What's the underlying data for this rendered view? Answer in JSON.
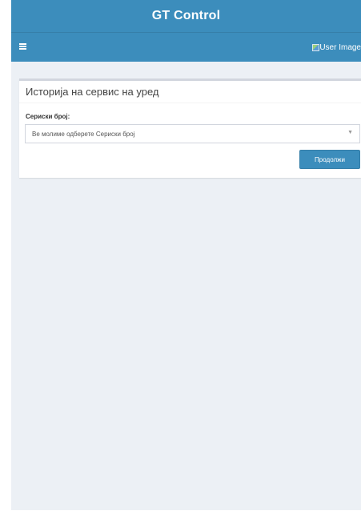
{
  "app": {
    "title": "GT Control"
  },
  "navbar": {
    "user_image_alt": "User Image"
  },
  "panel": {
    "title": "Историја на сервис на уред",
    "serial_label": "Сериски број:",
    "serial_placeholder": "Ве молиме одберете Сериски број",
    "continue_label": "Продолжи"
  },
  "colors": {
    "header": "#3c8dbc",
    "background": "#ecf0f5",
    "button": "#3c8dbc"
  },
  "icons": {
    "menu": "hamburger-icon",
    "dropdown": "chevron-down-icon",
    "user": "broken-image-icon"
  }
}
